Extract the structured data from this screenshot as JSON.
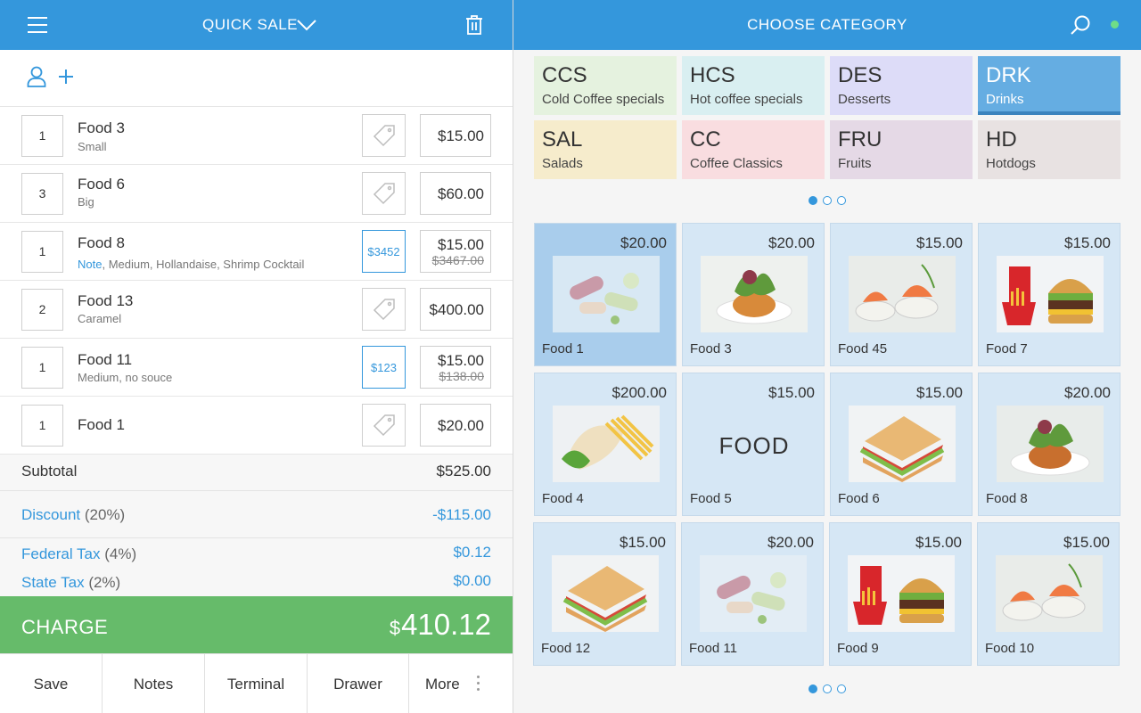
{
  "left_header": {
    "title": "QUICK SALE"
  },
  "order_items": [
    {
      "qty": "1",
      "name": "Food 3",
      "sub": "Small",
      "price": "$15.00"
    },
    {
      "qty": "3",
      "name": "Food 6",
      "sub": "Big",
      "price": "$60.00"
    },
    {
      "qty": "1",
      "name": "Food 8",
      "note_label": "Note",
      "sub": ", Medium, Hollandaise, Shrimp Cocktail",
      "discount": "$3452",
      "price": "$15.00",
      "original_price": "$3467.00"
    },
    {
      "qty": "2",
      "name": "Food 13",
      "sub": "Caramel",
      "price": "$400.00"
    },
    {
      "qty": "1",
      "name": "Food 11",
      "sub": "Medium, no souce",
      "discount": "$123",
      "price": "$15.00",
      "original_price": "$138.00"
    },
    {
      "qty": "1",
      "name": "Food 1",
      "price": "$20.00"
    }
  ],
  "totals": {
    "subtotal_label": "Subtotal",
    "subtotal": "$525.00",
    "discount_label": "Discount",
    "discount_pct": "(20%)",
    "discount": "-$115.00",
    "federal_label": "Federal Tax",
    "federal_pct": "(4%)",
    "federal": "$0.12",
    "state_label": "State Tax",
    "state_pct": "(2%)",
    "state": "$0.00"
  },
  "charge": {
    "label": "CHARGE",
    "currency": "$",
    "amount": "410.12"
  },
  "bottom_bar": {
    "save": "Save",
    "notes": "Notes",
    "terminal": "Terminal",
    "drawer": "Drawer",
    "more": "More"
  },
  "right_header": {
    "title": "CHOOSE CATEGORY"
  },
  "categories": [
    {
      "code": "CCS",
      "name": "Cold Coffee specials",
      "color": "#e5f2df"
    },
    {
      "code": "HCS",
      "name": "Hot coffee specials",
      "color": "#d9eff1"
    },
    {
      "code": "DES",
      "name": "Desserts",
      "color": "#dddcf8"
    },
    {
      "code": "DRK",
      "name": "Drinks",
      "color": "#65ade2"
    },
    {
      "code": "SAL",
      "name": "Salads",
      "color": "#f6eccc"
    },
    {
      "code": "CC",
      "name": "Coffee Classics",
      "color": "#f9dde0"
    },
    {
      "code": "FRU",
      "name": "Fruits",
      "color": "#e5d9e6"
    },
    {
      "code": "HD",
      "name": "Hotdogs",
      "color": "#e8e2e2"
    }
  ],
  "products": [
    {
      "name": "Food 1",
      "price": "$20.00",
      "icon": "wraps-image"
    },
    {
      "name": "Food 3",
      "price": "$20.00",
      "icon": "salad-plate-image"
    },
    {
      "name": "Food 45",
      "price": "$15.00",
      "icon": "salmon-bites-image"
    },
    {
      "name": "Food 7",
      "price": "$15.00",
      "icon": "burger-fries-image"
    },
    {
      "name": "Food 4",
      "price": "$200.00",
      "icon": "burrito-fries-image"
    },
    {
      "name": "Food 5",
      "price": "$15.00",
      "placeholder": "FOOD"
    },
    {
      "name": "Food 6",
      "price": "$15.00",
      "icon": "sandwich-image"
    },
    {
      "name": "Food 8",
      "price": "$20.00",
      "icon": "salad-plate-image"
    },
    {
      "name": "Food 12",
      "price": "$15.00",
      "icon": "sandwich-image"
    },
    {
      "name": "Food 11",
      "price": "$20.00",
      "icon": "wraps-image"
    },
    {
      "name": "Food 9",
      "price": "$15.00",
      "icon": "burger-fries-image"
    },
    {
      "name": "Food 10",
      "price": "$15.00",
      "icon": "salmon-bites-image"
    }
  ],
  "colors": {
    "header": "#3497dc",
    "charge": "#66bb6a",
    "product_tile": "#d6e7f5",
    "product_selected": "#a9cdec",
    "status_dot": "#6fdd88"
  }
}
